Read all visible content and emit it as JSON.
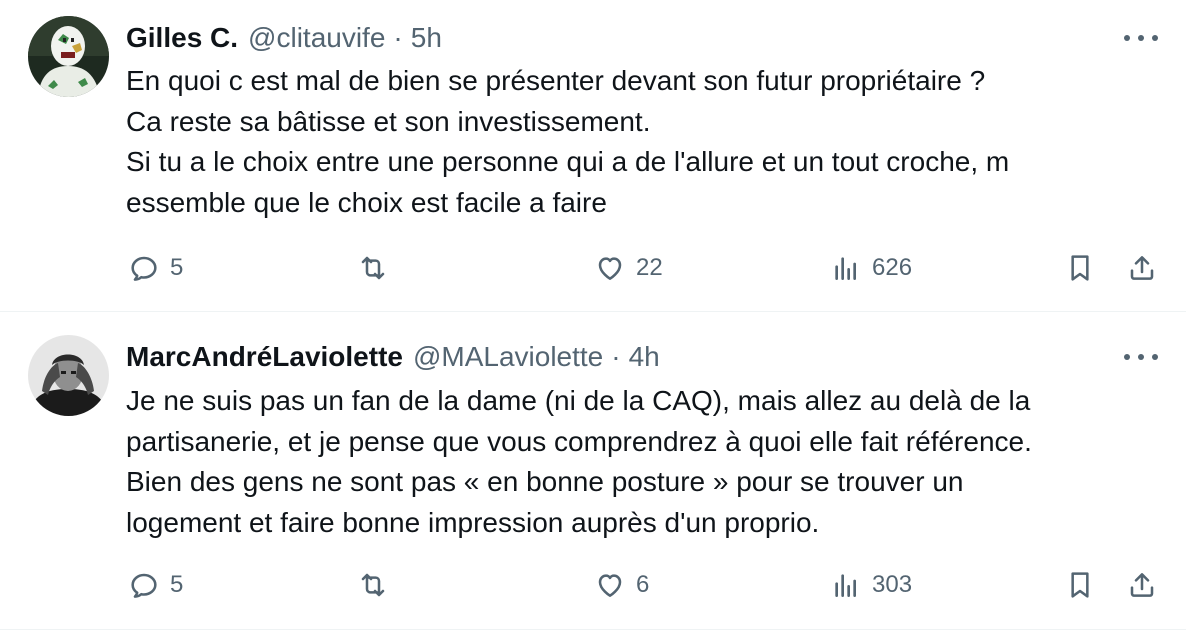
{
  "tweets": [
    {
      "name": "Gilles C.",
      "handle": "@clitauvife",
      "separator": "·",
      "time": "5h",
      "lines": [
        "En quoi c est mal de bien se présenter devant son futur propriétaire ?",
        "Ca reste sa bâtisse et son investissement.",
        "Si tu a le choix entre une personne qui a de l'allure et un tout croche,  m",
        "essemble que le choix est facile a faire"
      ],
      "replies": "5",
      "retweets": "",
      "likes": "22",
      "views": "626"
    },
    {
      "name": "MarcAndréLaviolette",
      "handle": "@MALaviolette",
      "separator": "·",
      "time": "4h",
      "lines": [
        "Je ne suis pas un fan de la dame (ni de la CAQ), mais allez au delà de la",
        "partisanerie, et je pense que vous comprendrez à quoi elle fait référence.",
        "Bien des gens ne sont pas « en bonne posture » pour se trouver un",
        "logement et faire bonne impression auprès d'un proprio."
      ],
      "replies": "5",
      "retweets": "",
      "likes": "6",
      "views": "303"
    }
  ],
  "icons": {
    "reply": "reply-icon",
    "retweet": "retweet-icon",
    "like": "like-icon",
    "views": "views-icon",
    "bookmark": "bookmark-icon",
    "share": "share-icon",
    "more": "more-icon"
  },
  "colors": {
    "text": "#0f1419",
    "secondary": "#536471",
    "divider": "#eff3f4"
  }
}
